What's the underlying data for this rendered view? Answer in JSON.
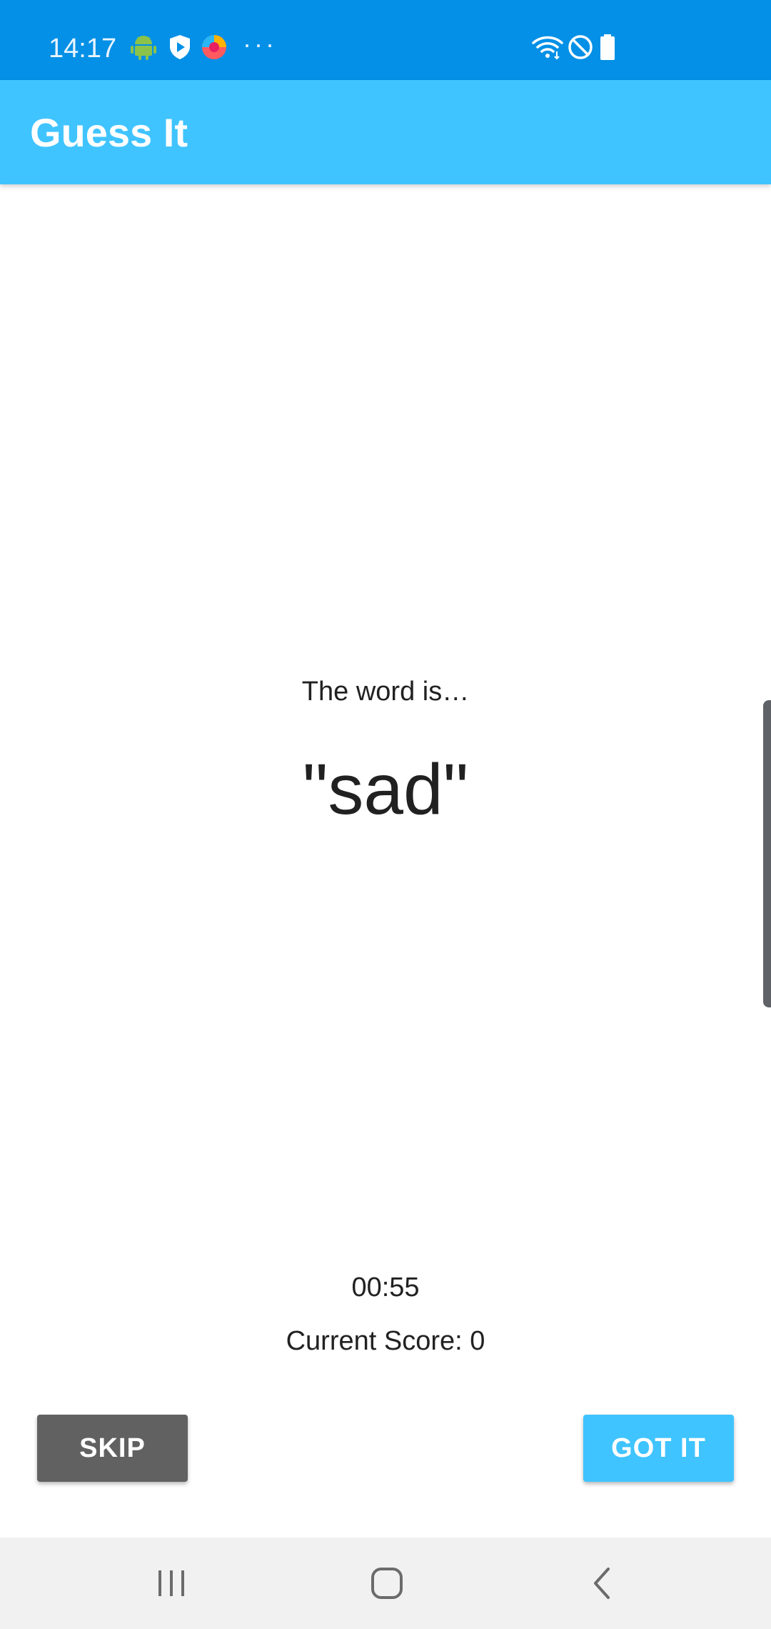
{
  "status_bar": {
    "time": "14:17",
    "overflow": "···",
    "icons": [
      "android-icon",
      "shield-play-icon",
      "browser-icon",
      "wifi-icon",
      "do-not-disturb-icon",
      "battery-icon"
    ],
    "colors": {
      "background": "#0390e6"
    }
  },
  "app_bar": {
    "title": "Guess It",
    "colors": {
      "background": "#40c4ff"
    }
  },
  "game": {
    "intro": "The word is…",
    "word": "\"sad\"",
    "timer": "00:55",
    "score_label": "Current Score: 0"
  },
  "buttons": {
    "skip_label": "SKIP",
    "got_it_label": "GOT IT",
    "colors": {
      "skip": "#616161",
      "got_it": "#40c4ff"
    }
  },
  "nav_bar": {
    "icons": [
      "recent-apps-icon",
      "home-icon",
      "back-icon"
    ]
  }
}
